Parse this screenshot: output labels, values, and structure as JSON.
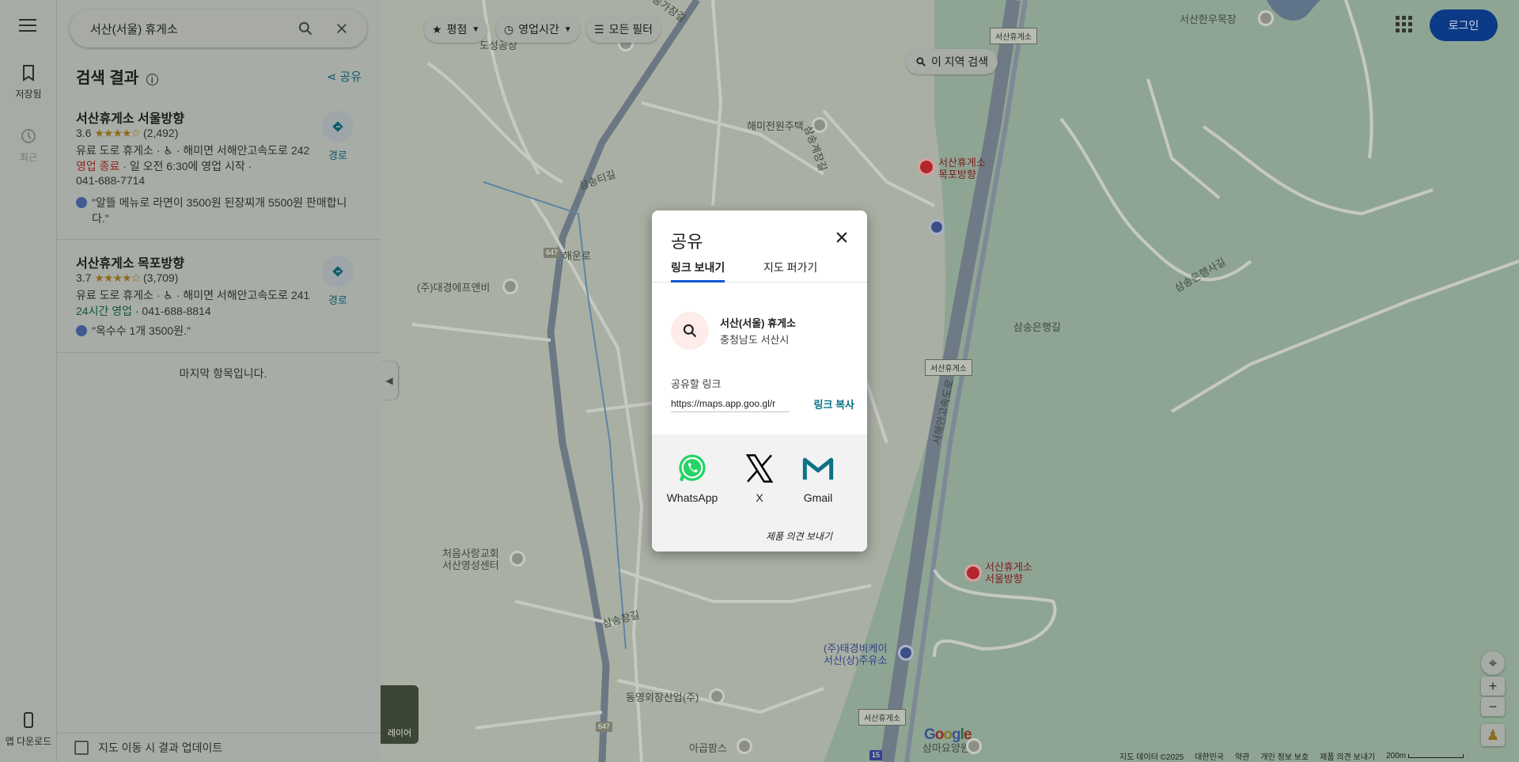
{
  "search": {
    "query": "서산(서울) 휴게소"
  },
  "rail": {
    "saved_label": "저장됨",
    "recent_label": "최근",
    "download_label": "앱 다운로드"
  },
  "panel": {
    "header": "검색 결과",
    "share_label": "공유",
    "results": [
      {
        "name": "서산휴게소 서울방향",
        "rating": "3.6",
        "stars": "★★★★☆",
        "reviews": "(2,492)",
        "line1": "유료 도로 휴게소 · ♿ · 해미면 서해안고속도로 242",
        "status": "영업 종료",
        "status_rest": " · 일 오전 6:30에 영업 시작 ·",
        "phone": "041-688-7714",
        "review": "\"알뜰 메뉴로 라면이 3500원 된장찌개 5500원 판매합니다.\"",
        "dir_label": "경로"
      },
      {
        "name": "서산휴게소 목포방향",
        "rating": "3.7",
        "stars": "★★★★☆",
        "reviews": "(3,709)",
        "line1": "유료 도로 휴게소 · ♿ · 해미면 서해안고속도로 241",
        "status": "24시간 영업",
        "status_rest": " · 041-688-8814",
        "review": "\"옥수수 1개 3500원.\"",
        "dir_label": "경로"
      }
    ],
    "end_note": "마지막 항목입니다.",
    "update_label": "지도 이동 시 결과 업데이트"
  },
  "chips": {
    "rating": "평점",
    "hours": "영업시간",
    "filters": "모든 필터",
    "area_search": "이 지역 검색"
  },
  "header_right": {
    "login": "로그인"
  },
  "map": {
    "labels": {
      "dosung": "도성공장",
      "haemi_jeonwon": "해미전원주택",
      "daegyeong": "(주)대경에프앤비",
      "first_church": "처음사랑교회\n서산영성센터",
      "dongyeong": "동영외장산업(주)",
      "agopms": "아곱팜스",
      "taegyeong": "(주)태경비케이\n서산(상)주유소",
      "samma": "삼마요양원",
      "seosan_hanwoo": "서산한우목장",
      "rest_mokpo": "서산휴게소\n목포방향",
      "rest_seoul": "서산휴게소\n서울방향",
      "samsong_eunhaeng": "삼송은행사길",
      "samsong_eunhaeng2": "삼송은행길",
      "haeun_ro": "해운로",
      "samsong_changgil": "삼송창길",
      "samsong_tigil": "삼송티길",
      "seohaean_express": "서해안고속도로",
      "samsong_gagil": "삼송가장길",
      "samsong_ggil": "삼송계장길"
    },
    "box_label": "서산휴게소",
    "route_647": "647",
    "route_15": "15",
    "layers_label": "레이어",
    "google": "Google",
    "footer": [
      "지도 데이터 ©2025",
      "대한민국",
      "약관",
      "개인 정보 보호",
      "제품 의견 보내기",
      "200m"
    ]
  },
  "dialog": {
    "title": "공유",
    "tab_send": "링크 보내기",
    "tab_embed": "지도 퍼가기",
    "place_name": "서산(서울) 휴게소",
    "place_addr": "충청남도 서산시",
    "link_label": "공유할 링크",
    "link_value": "https://maps.app.goo.gl/r",
    "copy_label": "링크 복사",
    "apps": [
      "WhatsApp",
      "X",
      "Gmail"
    ],
    "feedback": "제품 의견 보내기"
  },
  "colors": {
    "accent": "#0b57d0",
    "login_bg": "#0c3a86",
    "whatsapp": "#25d366",
    "gmail": "#0b7285"
  }
}
